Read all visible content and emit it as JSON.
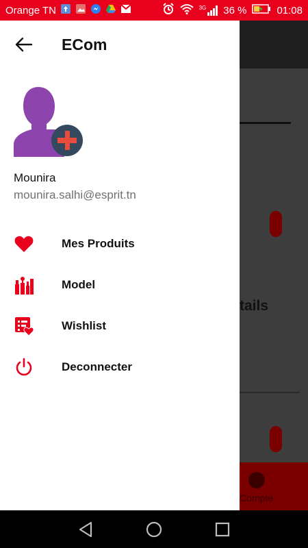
{
  "statusbar": {
    "carrier": "Orange TN",
    "network": "3G",
    "battery": "36 %",
    "time": "01:08"
  },
  "background": {
    "title_fragment": "tails",
    "nav_label": "Compte"
  },
  "drawer": {
    "title": "ECom",
    "user": {
      "name": "Mounira",
      "email": "mounira.salhi@esprit.tn"
    },
    "menu": [
      {
        "label": "Mes Produits",
        "icon": "heart-icon"
      },
      {
        "label": "Model",
        "icon": "tools-icon"
      },
      {
        "label": "Wishlist",
        "icon": "wishlist-icon"
      },
      {
        "label": "Deconnecter",
        "icon": "power-icon"
      }
    ]
  },
  "colors": {
    "accent": "#e8001c",
    "avatar": "#8e44ad",
    "avatar_badge": "#34495e"
  }
}
